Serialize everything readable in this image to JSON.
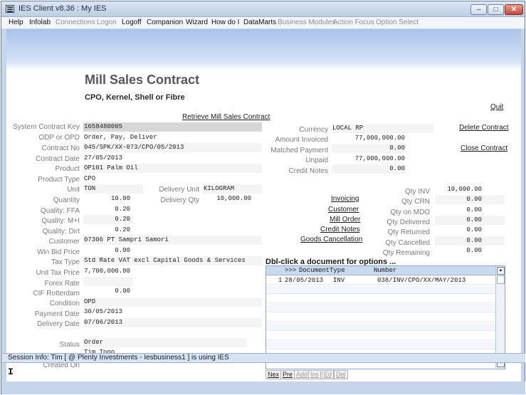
{
  "window": {
    "title": "IES Client v8.36 : My IES",
    "minimize": "–",
    "maximize": "□",
    "close": "✕"
  },
  "menu": [
    {
      "label": "Help",
      "enabled": true
    },
    {
      "label": "Infolab",
      "enabled": true
    },
    {
      "label": "Connections",
      "enabled": false
    },
    {
      "label": "Logon",
      "enabled": false
    },
    {
      "label": "Logoff",
      "enabled": true
    },
    {
      "label": "Companion",
      "enabled": true
    },
    {
      "label": "Wizard",
      "enabled": true
    },
    {
      "label": "How do I",
      "enabled": true
    },
    {
      "label": "DataMarts",
      "enabled": true
    },
    {
      "label": "Business Modules",
      "enabled": false
    },
    {
      "label": "Action Focus",
      "enabled": false
    },
    {
      "label": "Option Select",
      "enabled": false
    }
  ],
  "page": {
    "title": "Mill Sales Contract",
    "subtitle": "CPO, Kernel, Shell or Fibre"
  },
  "links": {
    "quit": "Quit",
    "retrieve": "Retrieve Mill Sales Contract",
    "delete": "Delete Contract",
    "close": "Close Contract",
    "invoicing": "Invoicing",
    "customer": "Customer",
    "mill_order": "Mill Order",
    "credit_notes": "Credit Notes",
    "goods_cancellation": "Goods Cancellation"
  },
  "fields": {
    "system_contract_key": {
      "label": "System Contract Key",
      "value": "1658480005"
    },
    "odp_or_opd": {
      "label": "ODP or OPD",
      "value": "Order, Pay, Deliver"
    },
    "contract_no": {
      "label": "Contract No",
      "value": "045/SPK/XX-073/CPO/05/2013"
    },
    "contract_date": {
      "label": "Contract Date",
      "value": "27/05/2013"
    },
    "product": {
      "label": "Product",
      "value": "OP101 Palm Oil"
    },
    "product_type": {
      "label": "Product Type",
      "value": "CPO"
    },
    "unit": {
      "label": "Unit",
      "value": "TON"
    },
    "delivery_unit": {
      "label": "Delivery Unit",
      "value": "KILOGRAM"
    },
    "quantity": {
      "label": "Quantity",
      "value": "10.00"
    },
    "delivery_qty": {
      "label": "Delivery Qty",
      "value": "10,000.00"
    },
    "quality_ffa": {
      "label": "Quality: FFA",
      "value": "0.20"
    },
    "quality_mi": {
      "label": "Quality: M+I",
      "value": "0.20"
    },
    "quality_dirt": {
      "label": "Quality: Dirt",
      "value": "0.20"
    },
    "customer": {
      "label": "Customer",
      "value": "07306 PT Sampri Samori"
    },
    "win_bid_price": {
      "label": "Win Bid Price",
      "value": "0.00"
    },
    "tax_type": {
      "label": "Tax Type",
      "value": "Std Rate VAT excl Capital Goods & Services"
    },
    "unit_tax_price": {
      "label": "Unit Tax Price",
      "value": "7,700,000.00"
    },
    "forex_rate": {
      "label": "Forex Rate",
      "value": ""
    },
    "cif_rotterdam": {
      "label": "CIF Rotterdam",
      "value": "0.00"
    },
    "condition": {
      "label": "Condition",
      "value": "OPD"
    },
    "payment_date": {
      "label": "Payment Date",
      "value": "30/05/2013"
    },
    "delivery_date": {
      "label": "Delivery Date",
      "value": "07/06/2013"
    },
    "status": {
      "label": "Status",
      "value": "Order"
    },
    "created_by": {
      "label": "",
      "value": "Tim Tono"
    },
    "created_on": {
      "label": "Created On",
      "value": ""
    }
  },
  "amounts": {
    "currency": {
      "label": "Currency",
      "value": "LOCAL RP"
    },
    "amount_invoiced": {
      "label": "Amount Invoiced",
      "value": "77,000,000.00"
    },
    "matched_payment": {
      "label": "Matched Payment",
      "value": "0.00"
    },
    "unpaid": {
      "label": "Unpaid",
      "value": "77,000,000.00"
    },
    "credit_notes": {
      "label": "Credit Notes",
      "value": "0.00"
    }
  },
  "quantities": {
    "qty_inv": {
      "label": "Qty INV",
      "value": "10,000.00"
    },
    "qty_crn": {
      "label": "Qty CRN",
      "value": "0.00"
    },
    "qty_on_mdo": {
      "label": "Qty on MDO",
      "value": "0.00"
    },
    "qty_delivered": {
      "label": "Qty Delivered",
      "value": "0.00"
    },
    "qty_returned": {
      "label": "Qty Returned",
      "value": "0.00"
    },
    "qty_cancelled": {
      "label": "Qty Cancelled",
      "value": "0.00"
    },
    "qty_remaining": {
      "label": "Qty Remaining",
      "value": "0.00"
    }
  },
  "documents": {
    "title": "Dbl-click a document for options ...",
    "columns": {
      "marker": ">>>",
      "date": "Document",
      "type": "Type",
      "number": "Number"
    },
    "rows": [
      {
        "index": "1",
        "date": "28/05/2013",
        "type": "INV",
        "number": "038/INV/CPO/XX/MAY/2013"
      }
    ],
    "scroll_up": "▲",
    "scroll_down": "▼",
    "nav": [
      {
        "label": "Nex",
        "enabled": true
      },
      {
        "label": "Pre",
        "enabled": true
      },
      {
        "label": "Add",
        "enabled": false
      },
      {
        "label": "Ins",
        "enabled": false
      },
      {
        "label": "Ed",
        "enabled": false
      },
      {
        "label": "Del",
        "enabled": false
      }
    ]
  },
  "status_bar": {
    "text": "Session Info: Tim [ @ Plenty Investments  - Iesbusiness1 ] is using IES"
  },
  "cursor": "I"
}
